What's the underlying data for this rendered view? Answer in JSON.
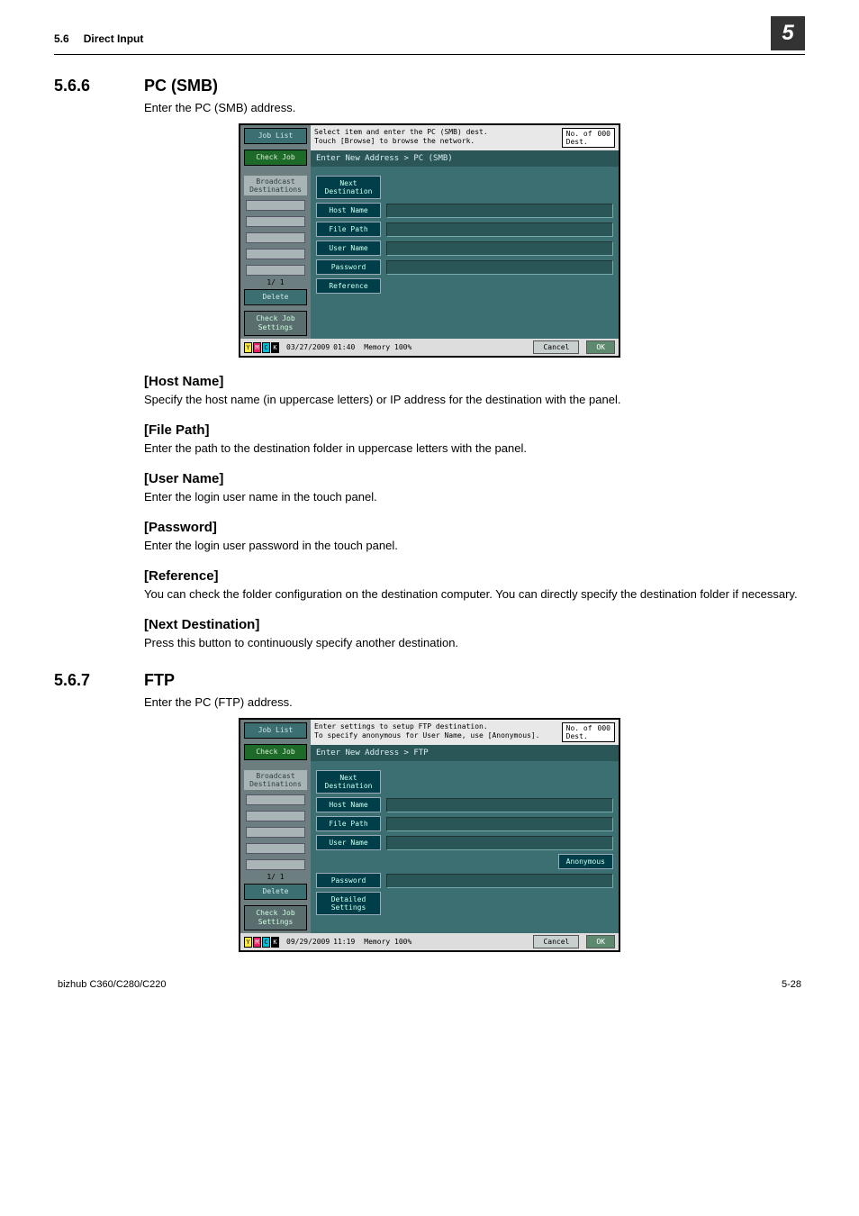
{
  "header": {
    "section_num": "5.6",
    "section_title": "Direct Input",
    "chapter": "5"
  },
  "sec566": {
    "num": "5.6.6",
    "title": "PC (SMB)",
    "intro": "Enter the PC (SMB) address."
  },
  "smb": {
    "job_list": "Job List",
    "check_job": "Check Job",
    "broadcast": "Broadcast\nDestinations",
    "pager": "1/  1",
    "delete": "Delete",
    "check_settings": "Check Job\nSettings",
    "msg": "Select item and enter the PC (SMB) dest.\nTouch [Browse] to browse the network.",
    "count_lbl": "No. of\nDest.",
    "count": "000",
    "crumb": "Enter New Address > PC (SMB)",
    "next_dest": "Next\nDestination",
    "host": "Host Name",
    "file": "File Path",
    "user": "User Name",
    "pass": "Password",
    "ref": "Reference",
    "date": "03/27/2009",
    "time": "01:40",
    "mem_lbl": "Memory",
    "mem": "100%",
    "cancel": "Cancel",
    "ok": "OK"
  },
  "subs": {
    "host": {
      "h": "[Host Name]",
      "t": "Specify the host name (in uppercase letters) or IP address for the destination with the panel."
    },
    "file": {
      "h": "[File Path]",
      "t": "Enter the path to the destination folder in uppercase letters with the panel."
    },
    "user": {
      "h": "[User Name]",
      "t": "Enter the login user name in the touch panel."
    },
    "pass": {
      "h": "[Password]",
      "t": "Enter the login user password in the touch panel."
    },
    "ref": {
      "h": "[Reference]",
      "t": "You can check the folder configuration on the destination computer. You can directly specify the destination folder if necessary."
    },
    "next": {
      "h": "[Next Destination]",
      "t": "Press this button to continuously specify another destination."
    }
  },
  "sec567": {
    "num": "5.6.7",
    "title": "FTP",
    "intro": "Enter the PC (FTP) address."
  },
  "ftp": {
    "job_list": "Job List",
    "check_job": "Check Job",
    "broadcast": "Broadcast\nDestinations",
    "pager": "1/  1",
    "delete": "Delete",
    "check_settings": "Check Job\nSettings",
    "msg": "Enter settings to setup FTP destination.\nTo specify anonymous for User Name, use [Anonymous].",
    "count_lbl": "No. of\nDest.",
    "count": "000",
    "crumb": "Enter New Address > FTP",
    "next_dest": "Next\nDestination",
    "host": "Host Name",
    "file": "File Path",
    "user": "User Name",
    "anon": "Anonymous",
    "pass": "Password",
    "det": "Detailed\nSettings",
    "date": "09/29/2009",
    "time": "11:19",
    "mem_lbl": "Memory",
    "mem": "100%",
    "cancel": "Cancel",
    "ok": "OK"
  },
  "footer": {
    "left": "bizhub C360/C280/C220",
    "right": "5-28"
  }
}
